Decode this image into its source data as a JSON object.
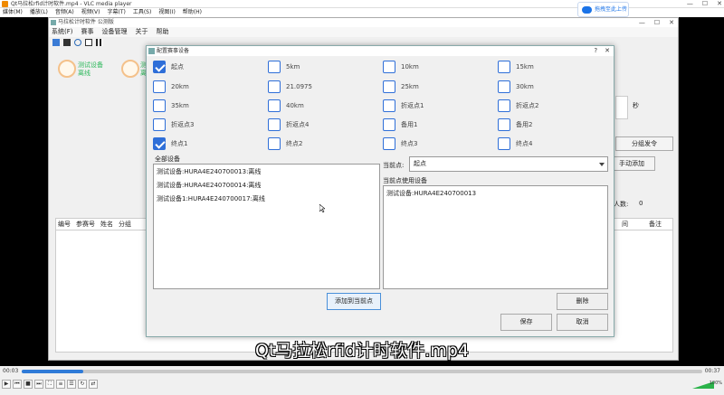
{
  "vlc": {
    "title": "Qt马拉松rfid计时软件.mp4 - VLC media player",
    "window_controls": [
      "—",
      "☐",
      "✕"
    ],
    "menu": [
      "媒体(M)",
      "播放(L)",
      "音频(A)",
      "视频(V)",
      "字幕(T)",
      "工具(S)",
      "视图(I)",
      "帮助(H)"
    ],
    "upload_button": "拖拽至此上传",
    "subtitle": "Qt马拉松rfid计时软件.mp4",
    "time_current": "00:03",
    "time_total": "00:37",
    "progress": 0.09,
    "volume_percent": "100%",
    "accent": "#2f7bd8"
  },
  "app": {
    "title": "马拉松计时软件 公测版",
    "menu": [
      "系统(F)",
      "赛事",
      "设备管理",
      "关于",
      "帮助"
    ],
    "devices": [
      {
        "label_line1": "测试设备",
        "label_line2": "离线"
      },
      {
        "label_line1": "测",
        "label_line2": "离"
      }
    ],
    "seconds_unit": "秒",
    "group_start_btn": "分组发令",
    "manual_add_btn": "手动添加",
    "people_count_label": "人数:",
    "people_count": "0",
    "table_headers": [
      "编号",
      "参赛号",
      "姓名",
      "分组"
    ],
    "table_headers_right": [
      "间",
      "备注"
    ]
  },
  "dialog": {
    "title": "配置赛事设备",
    "checkpoints": [
      {
        "label": "起点",
        "checked": true
      },
      {
        "label": "5km",
        "checked": false
      },
      {
        "label": "10km",
        "checked": false
      },
      {
        "label": "15km",
        "checked": false
      },
      {
        "label": "20km",
        "checked": false
      },
      {
        "label": "21.0975",
        "checked": false
      },
      {
        "label": "25km",
        "checked": false
      },
      {
        "label": "30km",
        "checked": false
      },
      {
        "label": "35km",
        "checked": false
      },
      {
        "label": "40km",
        "checked": false
      },
      {
        "label": "折返点1",
        "checked": false
      },
      {
        "label": "折返点2",
        "checked": false
      },
      {
        "label": "折返点3",
        "checked": false
      },
      {
        "label": "折返点4",
        "checked": false
      },
      {
        "label": "备用1",
        "checked": false
      },
      {
        "label": "备用2",
        "checked": false
      },
      {
        "label": "终点1",
        "checked": true
      },
      {
        "label": "终点2",
        "checked": false
      },
      {
        "label": "终点3",
        "checked": false
      },
      {
        "label": "终点4",
        "checked": false
      }
    ],
    "all_devices_label": "全部设备",
    "all_devices": [
      "测试设备:HURA4E240700013:离线",
      "测试设备:HURA4E240700014:离线",
      "测试设备1:HURA4E240700017:离线"
    ],
    "current_point_label": "当前点:",
    "current_point_value": "起点",
    "current_devices_label": "当前点使用设备",
    "current_devices": [
      "测试设备:HURA4E240700013"
    ],
    "add_button": "添加到当前点",
    "delete_button": "删除",
    "save_button": "保存",
    "cancel_button": "取消"
  }
}
